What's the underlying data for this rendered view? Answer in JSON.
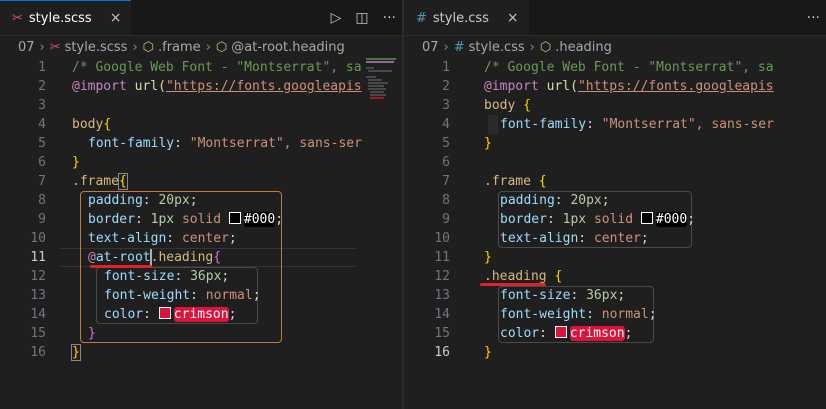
{
  "left": {
    "tab": {
      "icon": "scss-file-icon",
      "label": "style.scss",
      "close": "×"
    },
    "actions": {
      "run": "▷",
      "split": "◫",
      "more": "···"
    },
    "breadcrumb": [
      "07",
      "style.scss",
      ".frame",
      "@at-root.heading"
    ],
    "lines": [
      {
        "n": "1"
      },
      {
        "n": "2"
      },
      {
        "n": "3"
      },
      {
        "n": "4"
      },
      {
        "n": "5"
      },
      {
        "n": "6"
      },
      {
        "n": "7"
      },
      {
        "n": "8"
      },
      {
        "n": "9"
      },
      {
        "n": "10"
      },
      {
        "n": "11"
      },
      {
        "n": "12"
      },
      {
        "n": "13"
      },
      {
        "n": "14"
      },
      {
        "n": "15"
      },
      {
        "n": "16"
      }
    ],
    "code": {
      "l1": "/* Google Web Font - \"Montserrat\", sa",
      "l2_kw": "@import",
      "l2_fn": " url(",
      "l2_str": "\"https://fonts.googleapis",
      "l4_sel": "body",
      "l4_br": "{",
      "l5_prop": "font-family",
      "l5_val": "\"Montserrat\", sans-ser",
      "l6_br": "}",
      "l7_sel": ".frame",
      "l7_br": "{",
      "l8_prop": "padding",
      "l8_num": "20px",
      "l9_prop": "border",
      "l9_num": "1px",
      "l9_val": "solid",
      "l9_color": "#000",
      "l10_prop": "text-align",
      "l10_val": "center",
      "l11_at": "@",
      "l11_kw": "at-root",
      "l11_sel": ".heading",
      "l11_br": "{",
      "l12_prop": "font-size",
      "l12_num": "36px",
      "l13_prop": "font-weight",
      "l13_val": "normal",
      "l14_prop": "color",
      "l14_color": "crimson",
      "l15_br": "}",
      "l16_br": "}"
    }
  },
  "right": {
    "tab": {
      "icon": "css-file-icon",
      "prefix": "#",
      "label": "style.css",
      "close": "×"
    },
    "actions": {
      "more": "···"
    },
    "breadcrumb": [
      "07",
      "#",
      "style.css",
      ".heading"
    ],
    "lines": [
      {
        "n": "1"
      },
      {
        "n": "2"
      },
      {
        "n": "3"
      },
      {
        "n": "4"
      },
      {
        "n": "5"
      },
      {
        "n": "6"
      },
      {
        "n": "7"
      },
      {
        "n": "8"
      },
      {
        "n": "9"
      },
      {
        "n": "10"
      },
      {
        "n": "11"
      },
      {
        "n": "12"
      },
      {
        "n": "13"
      },
      {
        "n": "14"
      },
      {
        "n": "15"
      },
      {
        "n": "16"
      }
    ],
    "code": {
      "l1": "/* Google Web Font - \"Montserrat\", sa",
      "l2_kw": "@import",
      "l2_fn": " url(",
      "l2_str": "\"https://fonts.googleapis",
      "l3_sel": "body",
      "l3_br": "{",
      "l4_prop": "font-family",
      "l4_val": "\"Montserrat\", sans-ser",
      "l5_br": "}",
      "l7_sel": ".frame",
      "l7_br": "{",
      "l8_prop": "padding",
      "l8_num": "20px",
      "l9_prop": "border",
      "l9_num": "1px",
      "l9_val": "solid",
      "l9_color": "#000",
      "l10_prop": "text-align",
      "l10_val": "center",
      "l11_br": "}",
      "l12_sel": ".heading",
      "l12_br": "{",
      "l13_prop": "font-size",
      "l13_num": "36px",
      "l14_prop": "font-weight",
      "l14_val": "normal",
      "l15_prop": "color",
      "l15_color": "crimson",
      "l16_br": "}"
    }
  },
  "colors": {
    "accent": "#0078d4",
    "underline": "#e0202a",
    "crimson": "#dc143c",
    "box_orange": "#c27c3a"
  }
}
